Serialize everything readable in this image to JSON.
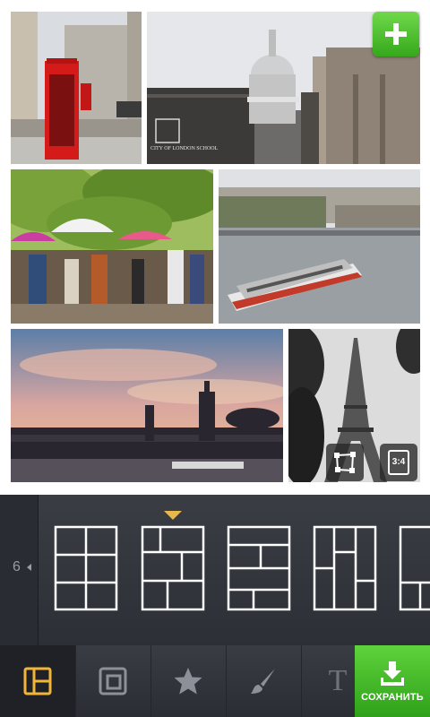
{
  "collage": {
    "photos": [
      {
        "name": "photo-london-phonebox",
        "desc": "red telephone booth"
      },
      {
        "name": "photo-st-pauls",
        "label": "CITY OF LONDON SCHOOL"
      },
      {
        "name": "photo-paris-artists"
      },
      {
        "name": "photo-seine-boat"
      },
      {
        "name": "photo-paris-sunset"
      },
      {
        "name": "photo-eiffel-tower"
      }
    ],
    "crop_label": "",
    "ratio_label": "3:4"
  },
  "picker": {
    "photo_count": "6",
    "layouts": [
      "grid-2x3",
      "staggered",
      "bricks",
      "columns",
      "partial"
    ]
  },
  "toolbar": {
    "tools": [
      "layout-tool",
      "frame-tool",
      "sticker-tool",
      "brush-tool",
      "text-tool"
    ],
    "text_tool_glyph": "T",
    "save_label": "СОХРАНИТЬ"
  },
  "colors": {
    "accent_green": "#3fb524",
    "marker": "#e8b84a",
    "active_tool": "#f0b53a"
  }
}
